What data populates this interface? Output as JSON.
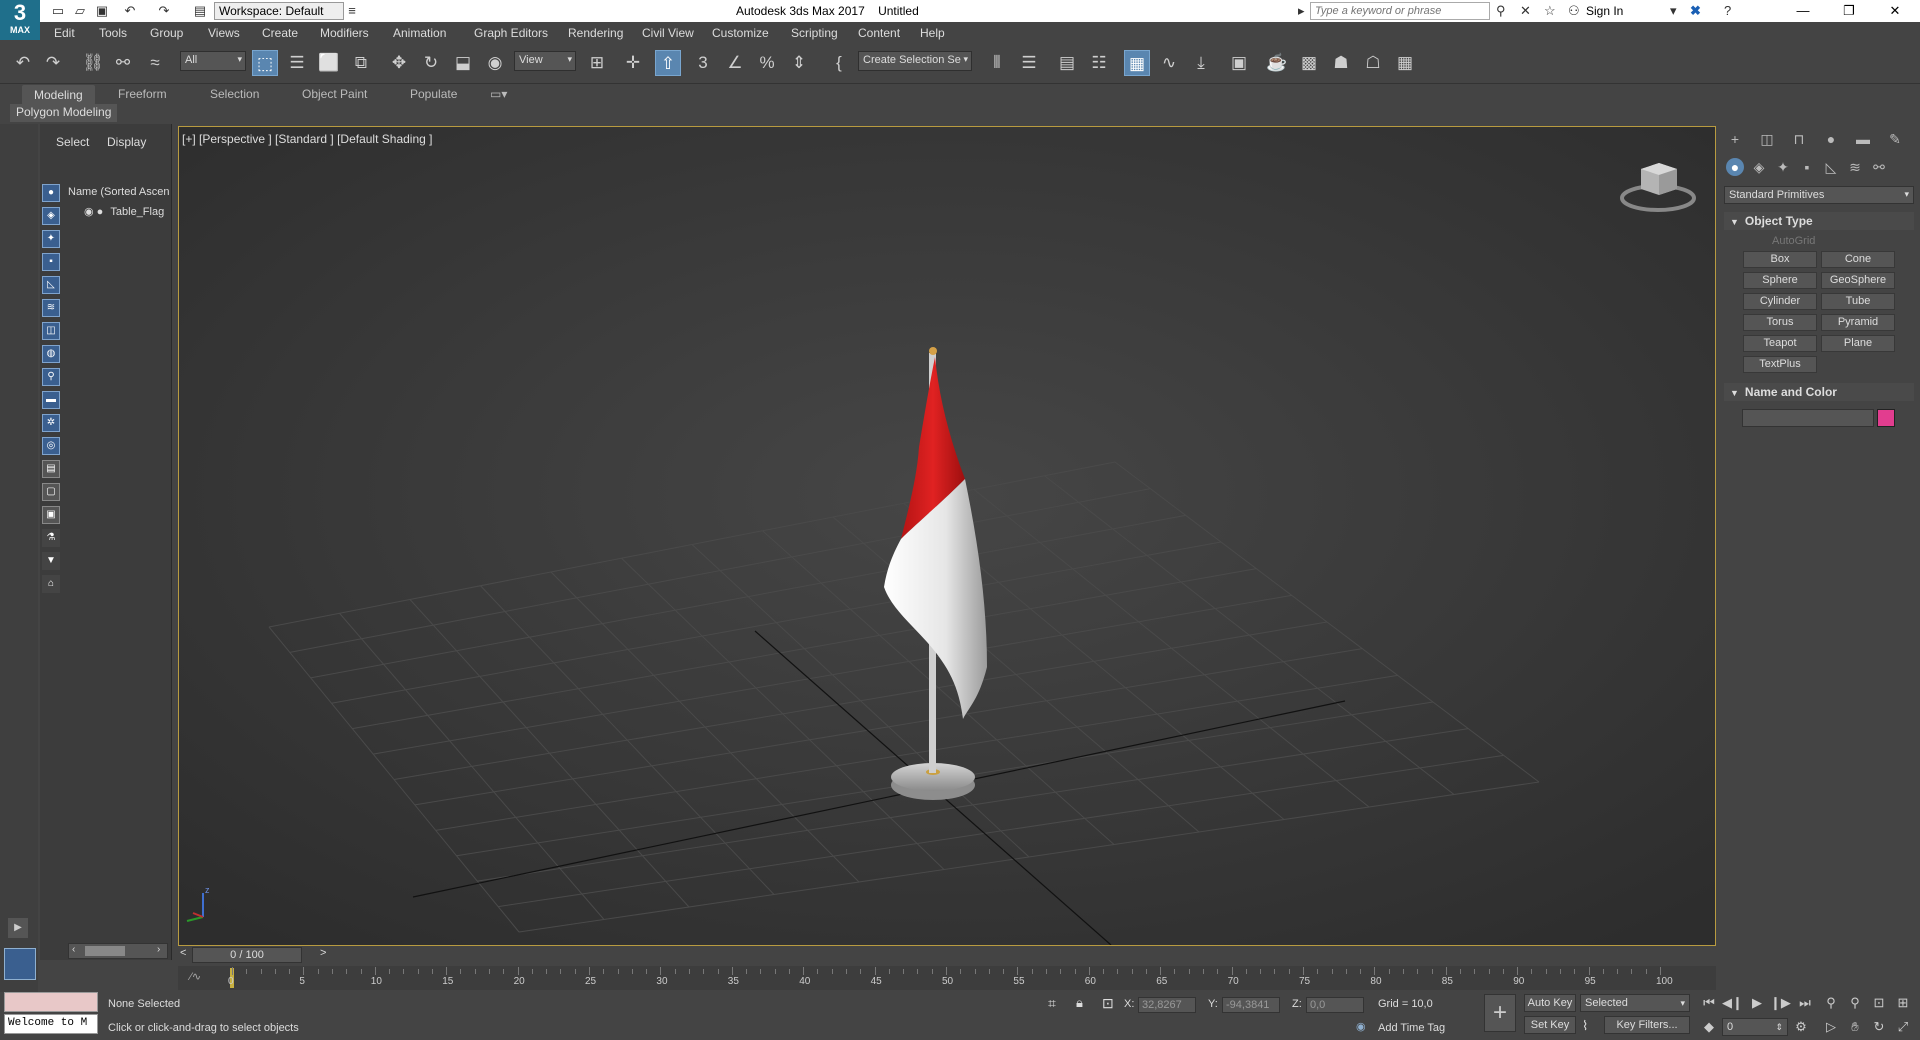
{
  "app": {
    "title": "Autodesk 3ds Max 2017",
    "document": "Untitled",
    "logo_number": "3",
    "logo_text": "MAX",
    "workspace": "Workspace: Default",
    "search_placeholder": "Type a keyword or phrase",
    "sign_in": "Sign In"
  },
  "menu": [
    "Edit",
    "Tools",
    "Group",
    "Views",
    "Create",
    "Modifiers",
    "Animation",
    "Graph Editors",
    "Rendering",
    "Civil View",
    "Customize",
    "Scripting",
    "Content",
    "Help"
  ],
  "toolbar": {
    "selection_filter": "All",
    "ref_coord": "View",
    "named_selection": "Create Selection Se"
  },
  "ribbon": {
    "tabs": [
      "Modeling",
      "Freeform",
      "Selection",
      "Object Paint",
      "Populate"
    ],
    "active_tab": "Modeling",
    "panel_label": "Polygon Modeling"
  },
  "scene_explorer": {
    "tabs": [
      "Select",
      "Display"
    ],
    "column_header": "Name (Sorted Ascen",
    "items": [
      "Table_Flag"
    ]
  },
  "viewport": {
    "label": "[+] [Perspective ] [Standard ] [Default Shading ]",
    "flag_colors": {
      "top": "#d81c1c",
      "bottom": "#e8e8e8"
    }
  },
  "command_panel": {
    "category": "Standard Primitives",
    "object_type_title": "Object Type",
    "autogrid": "AutoGrid",
    "primitives": [
      "Box",
      "Cone",
      "Sphere",
      "GeoSphere",
      "Cylinder",
      "Tube",
      "Torus",
      "Pyramid",
      "Teapot",
      "Plane",
      "TextPlus"
    ],
    "name_color_title": "Name and Color",
    "object_color": "#e23d8f"
  },
  "timeline": {
    "frame_display": "0 / 100",
    "ticks": [
      "0",
      "5",
      "10",
      "15",
      "20",
      "25",
      "30",
      "35",
      "40",
      "45",
      "50",
      "55",
      "60",
      "65",
      "70",
      "75",
      "80",
      "85",
      "90",
      "95",
      "100"
    ]
  },
  "status": {
    "listener_text": "Welcome to M",
    "selection": "None Selected",
    "prompt": "Click or click-and-drag to select objects",
    "x_label": "X:",
    "x_value": "32,8267",
    "y_label": "Y:",
    "y_value": "-94,3841",
    "z_label": "Z:",
    "z_value": "0,0",
    "grid": "Grid = 10,0",
    "add_time_tag": "Add Time Tag",
    "auto_key": "Auto Key",
    "set_key": "Set Key",
    "key_mode": "Selected",
    "key_filters": "Key Filters...",
    "current_frame": "0"
  }
}
